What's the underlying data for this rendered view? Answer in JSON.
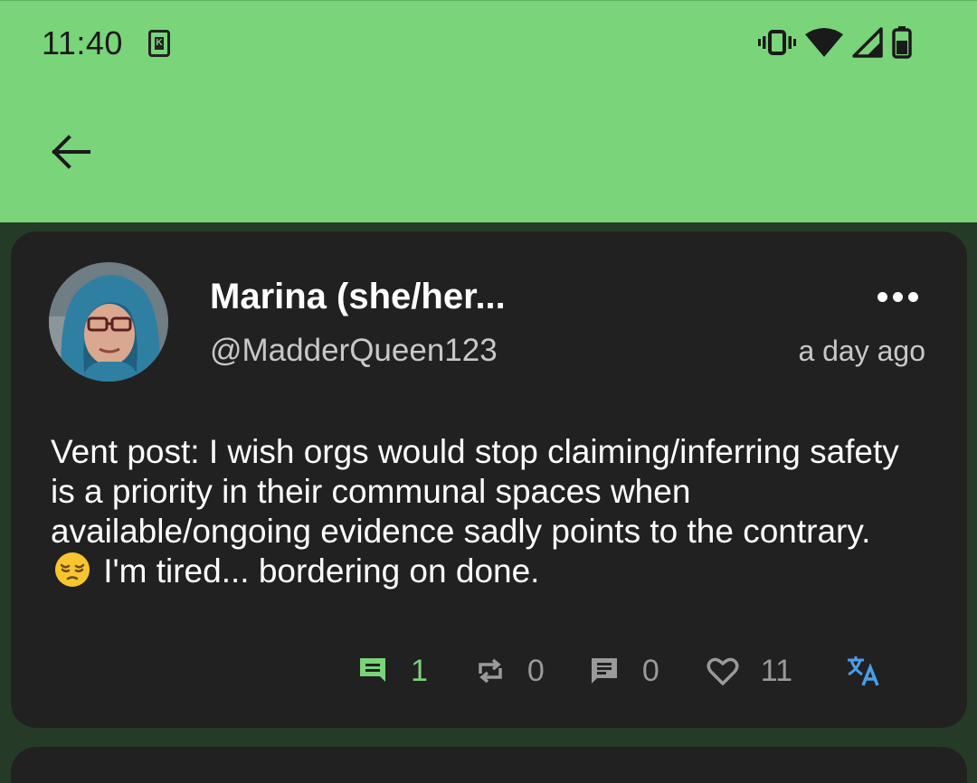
{
  "status_bar": {
    "time": "11:40",
    "notification_icon": "k-app-icon",
    "icons": [
      "vibrate-icon",
      "wifi-icon",
      "signal-icon",
      "battery-icon"
    ]
  },
  "app_bar": {
    "back_icon": "arrow-back-icon"
  },
  "post": {
    "display_name": "Marina (she/her...",
    "username": "@MadderQueen123",
    "timestamp": "a day ago",
    "content_before_emoji": "Vent post: I wish orgs would stop claiming/inferring safety is a priority in their communal spaces when available/ongoing evidence sadly points to the contrary.",
    "emoji": "pensive-face",
    "content_after_emoji": "I'm tired... bordering on done.",
    "actions": {
      "replies": "1",
      "boosts": "0",
      "quotes": "0",
      "favourites": "11"
    }
  },
  "colors": {
    "accent": "#7ad47a",
    "background": "#263b27",
    "card": "#212121",
    "translate": "#4a9ee8"
  }
}
